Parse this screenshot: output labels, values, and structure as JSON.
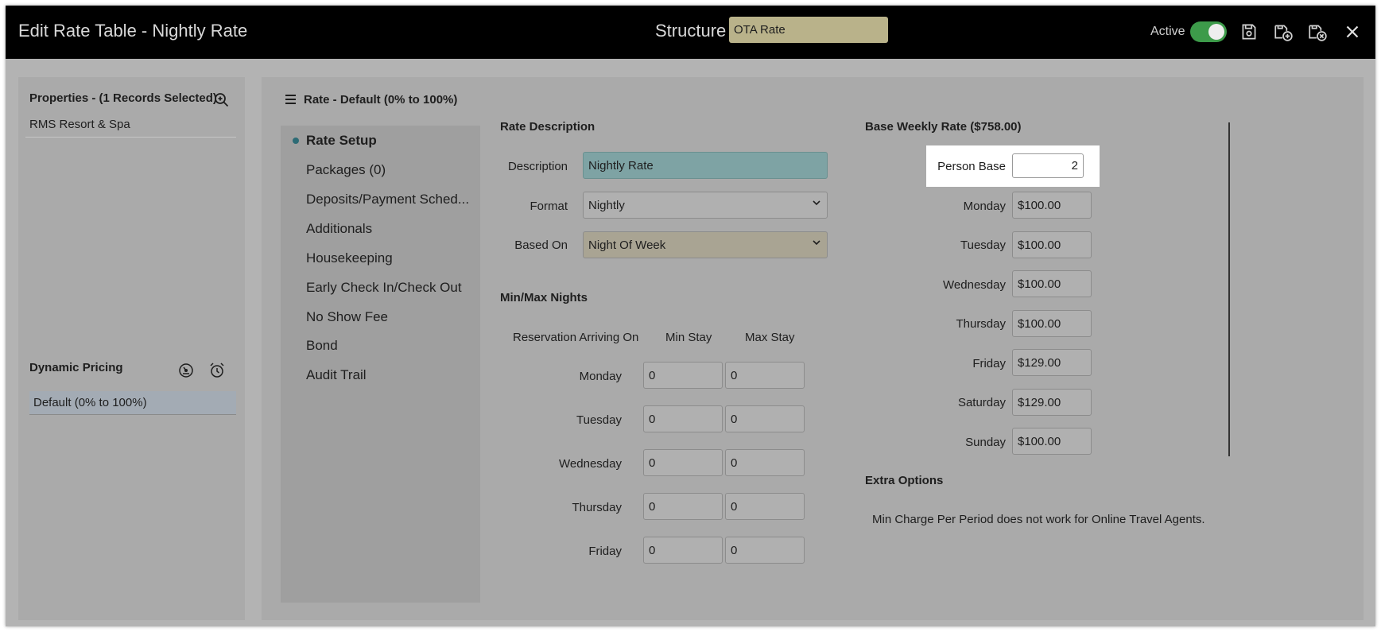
{
  "window": {
    "title": "Edit Rate Table - Nightly Rate",
    "structure_label": "Structure",
    "structure_value": "OTA Rate",
    "active_label": "Active",
    "active_on": true
  },
  "toolbar": {
    "icons": [
      "save-icon",
      "save-add-icon",
      "save-close-icon",
      "close-icon"
    ]
  },
  "properties": {
    "title": "Properties - (1 Records Selected)",
    "items": [
      "RMS Resort & Spa"
    ]
  },
  "dynamic_pricing": {
    "title": "Dynamic Pricing",
    "items": [
      "Default (0% to 100%)"
    ]
  },
  "rate": {
    "header": "Rate - Default (0% to 100%)"
  },
  "nav": {
    "items": [
      "Rate Setup",
      "Packages (0)",
      "Deposits/Payment Sched...",
      "Additionals",
      "Housekeeping",
      "Early Check In/Check Out",
      "No Show Fee",
      "Bond",
      "Audit Trail"
    ],
    "active": "Rate Setup"
  },
  "rate_description": {
    "title": "Rate Description",
    "description_label": "Description",
    "description_value": "Nightly Rate",
    "format_label": "Format",
    "format_value": "Nightly",
    "based_on_label": "Based On",
    "based_on_value": "Night Of Week"
  },
  "min_max": {
    "title": "Min/Max Nights",
    "col_arriving": "Reservation Arriving On",
    "col_min": "Min Stay",
    "col_max": "Max Stay",
    "rows": [
      {
        "day": "Monday",
        "min": "0",
        "max": "0"
      },
      {
        "day": "Tuesday",
        "min": "0",
        "max": "0"
      },
      {
        "day": "Wednesday",
        "min": "0",
        "max": "0"
      },
      {
        "day": "Thursday",
        "min": "0",
        "max": "0"
      },
      {
        "day": "Friday",
        "min": "0",
        "max": "0"
      }
    ]
  },
  "base_weekly": {
    "title": "Base Weekly Rate ($758.00)",
    "person_base_label": "Person Base",
    "person_base_value": "2",
    "rows": [
      {
        "day": "Monday",
        "value": "$100.00"
      },
      {
        "day": "Tuesday",
        "value": "$100.00"
      },
      {
        "day": "Wednesday",
        "value": "$100.00"
      },
      {
        "day": "Thursday",
        "value": "$100.00"
      },
      {
        "day": "Friday",
        "value": "$129.00"
      },
      {
        "day": "Saturday",
        "value": "$129.00"
      },
      {
        "day": "Sunday",
        "value": "$100.00"
      }
    ]
  },
  "extra_options": {
    "title": "Extra Options",
    "note": "Min Charge Per Period does not work for Online Travel Agents."
  }
}
